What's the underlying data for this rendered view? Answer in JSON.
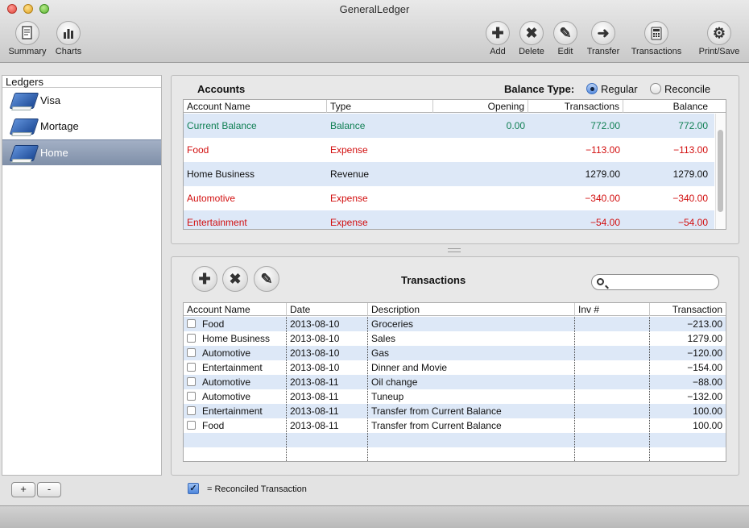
{
  "window": {
    "title": "GeneralLedger"
  },
  "toolbar": {
    "left": [
      {
        "label": "Summary",
        "icon": "summary-icon"
      },
      {
        "label": "Charts",
        "icon": "charts-icon"
      }
    ],
    "right": [
      {
        "label": "Add",
        "icon": "add-icon"
      },
      {
        "label": "Delete",
        "icon": "delete-icon"
      },
      {
        "label": "Edit",
        "icon": "edit-icon"
      },
      {
        "label": "Transfer",
        "icon": "transfer-icon"
      },
      {
        "label": "Transactions",
        "icon": "calculator-icon"
      },
      {
        "label": "Print/Save",
        "icon": "gear-icon"
      }
    ]
  },
  "sidebar": {
    "header": "Ledgers",
    "items": [
      {
        "label": "Visa",
        "selected": false
      },
      {
        "label": "Mortage",
        "selected": false
      },
      {
        "label": "Home",
        "selected": true
      }
    ],
    "add_label": "+",
    "remove_label": "-"
  },
  "accounts": {
    "title": "Accounts",
    "balance_type_label": "Balance Type:",
    "options": [
      "Regular",
      "Reconcile"
    ],
    "selected_option": "Regular",
    "columns": [
      "Account Name",
      "Type",
      "Opening",
      "Transactions",
      "Balance"
    ],
    "rows": [
      {
        "name": "Current Balance",
        "type": "Balance",
        "opening": "0.00",
        "transactions": "772.00",
        "balance": "772.00",
        "color": "#0f7f53"
      },
      {
        "name": "Food",
        "type": "Expense",
        "opening": "",
        "transactions": "−113.00",
        "balance": "−113.00",
        "color": "#d20f0f"
      },
      {
        "name": "Home Business",
        "type": "Revenue",
        "opening": "",
        "transactions": "1279.00",
        "balance": "1279.00",
        "color": "#111111"
      },
      {
        "name": "Automotive",
        "type": "Expense",
        "opening": "",
        "transactions": "−340.00",
        "balance": "−340.00",
        "color": "#d20f0f"
      },
      {
        "name": "Entertainment",
        "type": "Expense",
        "opening": "",
        "transactions": "−54.00",
        "balance": "−54.00",
        "color": "#d20f0f"
      }
    ]
  },
  "transactions": {
    "title": "Transactions",
    "search_placeholder": "",
    "columns": [
      "Account Name",
      "Date",
      "Description",
      "Inv #",
      "Transaction"
    ],
    "rows": [
      {
        "account": "Food",
        "date": "2013-08-10",
        "description": "Groceries",
        "inv": "",
        "amount": "−213.00"
      },
      {
        "account": "Home Business",
        "date": "2013-08-10",
        "description": "Sales",
        "inv": "",
        "amount": "1279.00"
      },
      {
        "account": "Automotive",
        "date": "2013-08-10",
        "description": "Gas",
        "inv": "",
        "amount": "−120.00"
      },
      {
        "account": "Entertainment",
        "date": "2013-08-10",
        "description": "Dinner and Movie",
        "inv": "",
        "amount": "−154.00"
      },
      {
        "account": "Automotive",
        "date": "2013-08-11",
        "description": "Oil change",
        "inv": "",
        "amount": "−88.00"
      },
      {
        "account": "Automotive",
        "date": "2013-08-11",
        "description": "Tuneup",
        "inv": "",
        "amount": "−132.00"
      },
      {
        "account": "Entertainment",
        "date": "2013-08-11",
        "description": "Transfer from Current Balance",
        "inv": "",
        "amount": "100.00"
      },
      {
        "account": "Food",
        "date": "2013-08-11",
        "description": "Transfer from Current Balance",
        "inv": "",
        "amount": "100.00"
      }
    ]
  },
  "legend": {
    "text": "= Reconciled Transaction"
  }
}
